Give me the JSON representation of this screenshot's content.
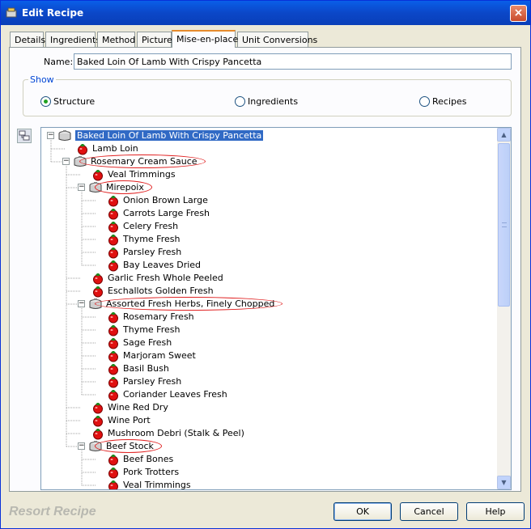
{
  "window": {
    "title": "Edit Recipe",
    "close_glyph": "×"
  },
  "tabs": [
    {
      "label": "Details"
    },
    {
      "label": "Ingredients"
    },
    {
      "label": "Method"
    },
    {
      "label": "Picture"
    },
    {
      "label": "Mise-en-place",
      "active": true
    },
    {
      "label": "Unit Conversions"
    }
  ],
  "name": {
    "label": "Name:",
    "value": "Baked Loin Of Lamb With Crispy Pancetta"
  },
  "show": {
    "legend": "Show",
    "options": [
      {
        "label": "Structure",
        "checked": true
      },
      {
        "label": "Ingredients",
        "checked": false
      },
      {
        "label": "Recipes",
        "checked": false
      }
    ]
  },
  "tree": [
    {
      "label": "Baked Loin Of Lamb With Crispy Pancetta",
      "level": 0,
      "type": "recipe",
      "expanded": true,
      "selected": true
    },
    {
      "label": "Lamb Loin",
      "level": 1,
      "type": "ingredient"
    },
    {
      "label": "Rosemary Cream Sauce",
      "level": 1,
      "type": "recipe",
      "expanded": true,
      "circled": true
    },
    {
      "label": "Veal Trimmings",
      "level": 2,
      "type": "ingredient"
    },
    {
      "label": "Mirepoix",
      "level": 2,
      "type": "recipe",
      "expanded": true,
      "circled": true
    },
    {
      "label": "Onion Brown Large",
      "level": 3,
      "type": "ingredient"
    },
    {
      "label": "Carrots Large Fresh",
      "level": 3,
      "type": "ingredient"
    },
    {
      "label": "Celery Fresh",
      "level": 3,
      "type": "ingredient"
    },
    {
      "label": "Thyme Fresh",
      "level": 3,
      "type": "ingredient"
    },
    {
      "label": "Parsley Fresh",
      "level": 3,
      "type": "ingredient"
    },
    {
      "label": "Bay Leaves Dried",
      "level": 3,
      "type": "ingredient"
    },
    {
      "label": "Garlic Fresh Whole Peeled",
      "level": 2,
      "type": "ingredient"
    },
    {
      "label": "Eschallots Golden Fresh",
      "level": 2,
      "type": "ingredient"
    },
    {
      "label": "Assorted Fresh Herbs, Finely Chopped",
      "level": 2,
      "type": "recipe",
      "expanded": true,
      "circled": true
    },
    {
      "label": "Rosemary Fresh",
      "level": 3,
      "type": "ingredient"
    },
    {
      "label": "Thyme Fresh",
      "level": 3,
      "type": "ingredient"
    },
    {
      "label": "Sage Fresh",
      "level": 3,
      "type": "ingredient"
    },
    {
      "label": "Marjoram Sweet",
      "level": 3,
      "type": "ingredient"
    },
    {
      "label": "Basil Bush",
      "level": 3,
      "type": "ingredient"
    },
    {
      "label": "Parsley Fresh",
      "level": 3,
      "type": "ingredient"
    },
    {
      "label": "Coriander Leaves Fresh",
      "level": 3,
      "type": "ingredient"
    },
    {
      "label": "Wine Red Dry",
      "level": 2,
      "type": "ingredient"
    },
    {
      "label": "Wine Port",
      "level": 2,
      "type": "ingredient"
    },
    {
      "label": "Mushroom Debri (Stalk & Peel)",
      "level": 2,
      "type": "ingredient"
    },
    {
      "label": "Beef Stock",
      "level": 2,
      "type": "recipe",
      "expanded": true,
      "circled": true
    },
    {
      "label": "Beef Bones",
      "level": 3,
      "type": "ingredient"
    },
    {
      "label": "Pork Trotters",
      "level": 3,
      "type": "ingredient"
    },
    {
      "label": "Veal Trimmings",
      "level": 3,
      "type": "ingredient"
    }
  ],
  "scrollbar": {
    "up_glyph": "▲",
    "down_glyph": "▼"
  },
  "footer": {
    "brand": "Resort Recipe",
    "ok_label": "OK",
    "cancel_label": "Cancel",
    "help_label": "Help"
  },
  "colors": {
    "titlebar": "#0b47c8",
    "selection": "#316ac5",
    "annotation_circle": "#e02020",
    "ingredient_icon": "#e01010",
    "tab_active_accent": "#e68b2c"
  },
  "icons": {
    "recipe": "cooking-pot-icon",
    "ingredient": "tomato-icon",
    "side_tool": "tree-view-toggle-icon"
  }
}
